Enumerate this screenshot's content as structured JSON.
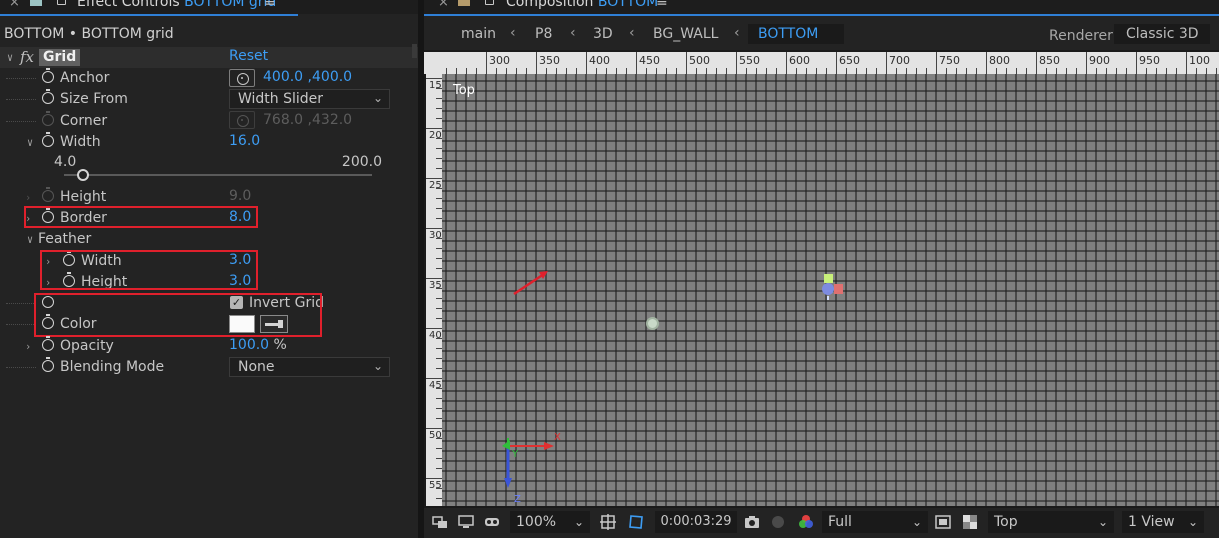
{
  "effect_controls": {
    "tab_close": "×",
    "tab_title_prefix": "Effect Controls",
    "tab_title_layer": "BOTTOM grid",
    "tab_menu": "≡",
    "header": "BOTTOM • BOTTOM grid",
    "fx_label": "fx",
    "effect_name": "Grid",
    "reset_label": "Reset",
    "props": {
      "anchor": {
        "label": "Anchor",
        "value_x": "400.0",
        "value_sep": " ,",
        "value_y": "400.0"
      },
      "size_from": {
        "label": "Size From",
        "value": "Width Slider"
      },
      "corner": {
        "label": "Corner",
        "value_x": "768.0",
        "value_sep": " ,",
        "value_y": "432.0"
      },
      "width": {
        "label": "Width",
        "value": "16.0",
        "slider_min": "4.0",
        "slider_max": "200.0",
        "slider_fraction": 0.061
      },
      "height": {
        "label": "Height",
        "value": "9.0"
      },
      "border": {
        "label": "Border",
        "value": "8.0"
      },
      "feather": {
        "label": "Feather"
      },
      "feather_width": {
        "label": "Width",
        "value": "3.0"
      },
      "feather_height": {
        "label": "Height",
        "value": "3.0"
      },
      "invert_grid": {
        "label": "Invert Grid",
        "checked": true
      },
      "color": {
        "label": "Color",
        "swatch": "#fafafa"
      },
      "opacity": {
        "label": "Opacity",
        "value": "100.0",
        "unit": "%"
      },
      "blending_mode": {
        "label": "Blending Mode",
        "value": "None"
      }
    }
  },
  "composition": {
    "tab_close": "×",
    "tab_title_prefix": "Composition",
    "tab_title_comp": "BOTTOM",
    "tab_menu": "≡",
    "breadcrumbs": [
      "main",
      "P8",
      "3D",
      "BG_WALL",
      "BOTTOM"
    ],
    "renderer_label": "Renderer:",
    "renderer_value": "Classic 3D",
    "view_label": "Top",
    "ruler_top": [
      "300",
      "350",
      "400",
      "450",
      "500",
      "550",
      "600",
      "650",
      "700",
      "750",
      "800",
      "850",
      "900",
      "950",
      "100"
    ],
    "ruler_left": [
      "150",
      "200",
      "250",
      "300",
      "350",
      "400",
      "450",
      "500",
      "55"
    ],
    "toolbar": {
      "zoom": "100%",
      "timecode": "0:00:03:29",
      "resolution": "Full",
      "view": "Top",
      "views": "1 View"
    },
    "axis_labels": {
      "x": "X",
      "y": "Y",
      "z": "Z"
    }
  },
  "colors": {
    "accent_blue": "#3d9df4",
    "highlight_red": "#e0202c",
    "grid_fill": "#808080"
  }
}
